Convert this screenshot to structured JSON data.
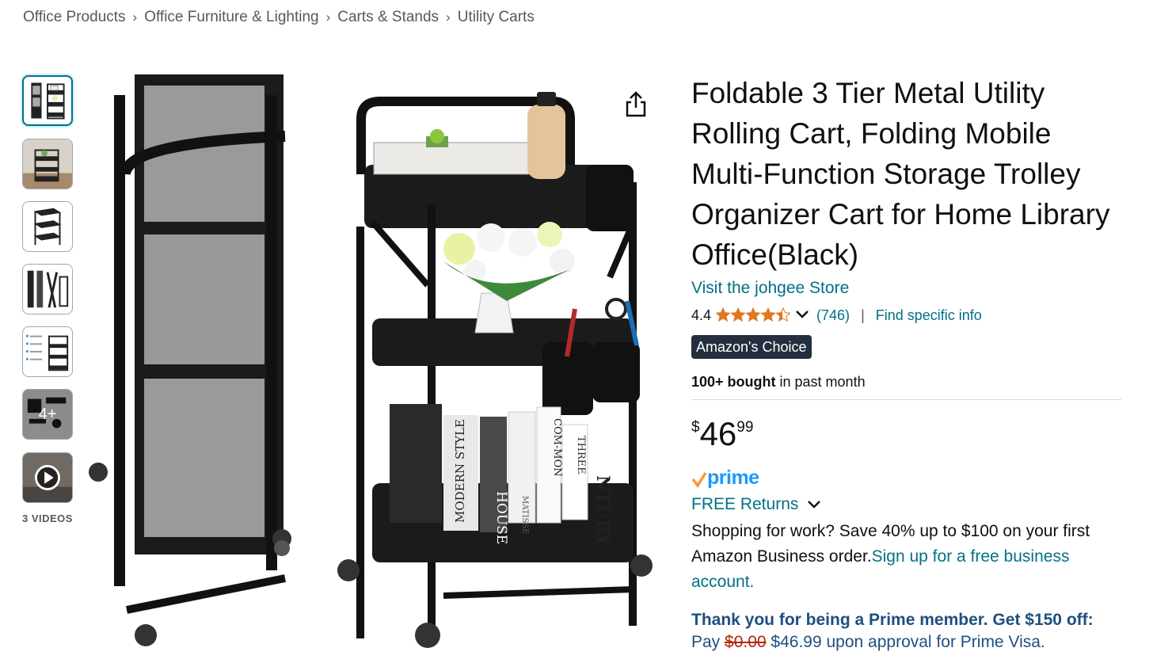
{
  "breadcrumb": [
    "Office Products",
    "Office Furniture & Lighting",
    "Carts & Stands",
    "Utility Carts"
  ],
  "thumbnails": {
    "more_overlay": "4+",
    "videos_label": "3 VIDEOS"
  },
  "product": {
    "title": "Foldable 3 Tier Metal Utility Rolling Cart, Folding Mobile Multi-Function Storage Trolley Organizer Cart for Home Library Office(Black)",
    "store_link": "Visit the johgee Store",
    "rating": "4.4",
    "rating_stars": 4.4,
    "review_count": "(746)",
    "divider": "|",
    "find_info": "Find specific info",
    "badge": "Amazon's Choice",
    "bought_bold": "100+ bought",
    "bought_rest": " in past month",
    "price_symbol": "$",
    "price_whole": "46",
    "price_fraction": "99",
    "prime_label": "prime",
    "returns_label": "FREE Returns",
    "business_text": "Shopping for work? Save 40% up to $100 on your first Amazon Business order.",
    "business_link": "Sign up for a free business account.",
    "prime_offer": "Thank you for being a Prime member. Get $150 off:",
    "prime_offer_pay": "Pay ",
    "prime_offer_strike": "$0.00",
    "prime_offer_rest": " $46.99 upon approval for Prime Visa."
  },
  "book_spines": [
    "MODERN STYLE",
    "HOUSE",
    "MATISSE",
    "COM-MON",
    "THREE",
    "NTURY"
  ],
  "colors": {
    "link": "#007185",
    "star": "#de7921",
    "prime": "#1a98ff",
    "badge_bg": "#232f3e",
    "offer": "#1f4f80"
  },
  "icons": [
    "share-icon",
    "star-icon",
    "chevron-down-icon",
    "play-icon"
  ]
}
